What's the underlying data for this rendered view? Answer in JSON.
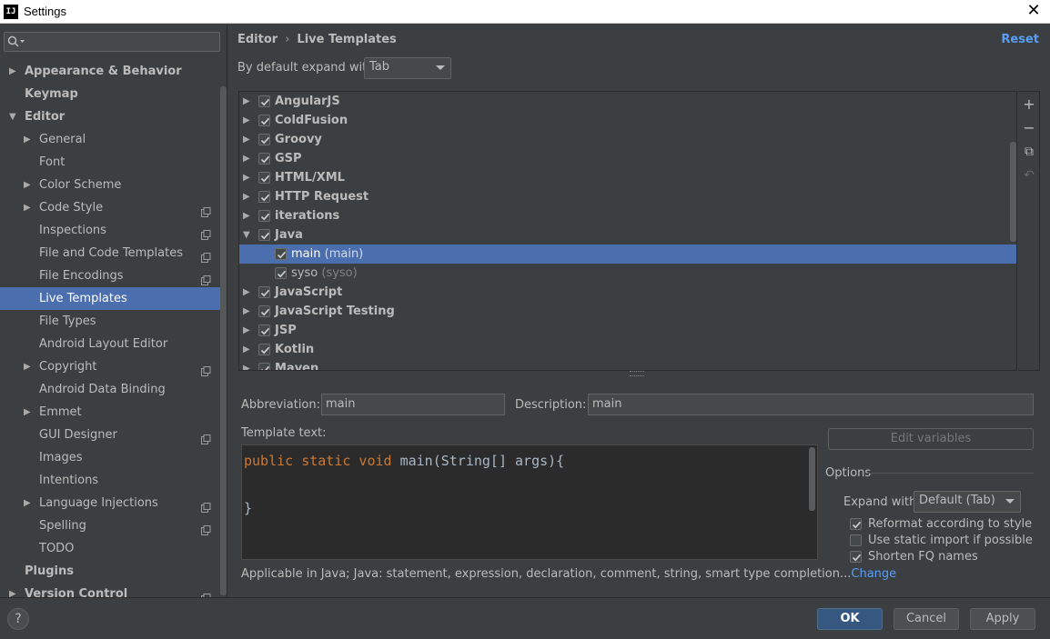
{
  "window": {
    "title": "Settings",
    "app_icon": "IJ",
    "close_glyph": "✕"
  },
  "search": {
    "placeholder": "",
    "value": ""
  },
  "sidebar": {
    "items": [
      {
        "label": "Appearance & Behavior",
        "level": 0,
        "bold": true,
        "arrow": "right"
      },
      {
        "label": "Keymap",
        "level": 0,
        "bold": true,
        "arrow": ""
      },
      {
        "label": "Editor",
        "level": 0,
        "bold": true,
        "arrow": "down"
      },
      {
        "label": "General",
        "level": 1,
        "bold": false,
        "arrow": "right"
      },
      {
        "label": "Font",
        "level": 1,
        "bold": false,
        "arrow": ""
      },
      {
        "label": "Color Scheme",
        "level": 1,
        "bold": false,
        "arrow": "right"
      },
      {
        "label": "Code Style",
        "level": 1,
        "bold": false,
        "arrow": "right",
        "project": true
      },
      {
        "label": "Inspections",
        "level": 1,
        "bold": false,
        "arrow": "",
        "project": true
      },
      {
        "label": "File and Code Templates",
        "level": 1,
        "bold": false,
        "arrow": "",
        "project": true
      },
      {
        "label": "File Encodings",
        "level": 1,
        "bold": false,
        "arrow": "",
        "project": true
      },
      {
        "label": "Live Templates",
        "level": 1,
        "bold": false,
        "arrow": "",
        "selected": true
      },
      {
        "label": "File Types",
        "level": 1,
        "bold": false,
        "arrow": ""
      },
      {
        "label": "Android Layout Editor",
        "level": 1,
        "bold": false,
        "arrow": ""
      },
      {
        "label": "Copyright",
        "level": 1,
        "bold": false,
        "arrow": "right",
        "project": true
      },
      {
        "label": "Android Data Binding",
        "level": 1,
        "bold": false,
        "arrow": ""
      },
      {
        "label": "Emmet",
        "level": 1,
        "bold": false,
        "arrow": "right"
      },
      {
        "label": "GUI Designer",
        "level": 1,
        "bold": false,
        "arrow": "",
        "project": true
      },
      {
        "label": "Images",
        "level": 1,
        "bold": false,
        "arrow": ""
      },
      {
        "label": "Intentions",
        "level": 1,
        "bold": false,
        "arrow": ""
      },
      {
        "label": "Language Injections",
        "level": 1,
        "bold": false,
        "arrow": "right",
        "project": true
      },
      {
        "label": "Spelling",
        "level": 1,
        "bold": false,
        "arrow": "",
        "project": true
      },
      {
        "label": "TODO",
        "level": 1,
        "bold": false,
        "arrow": ""
      },
      {
        "label": "Plugins",
        "level": 0,
        "bold": true,
        "arrow": ""
      },
      {
        "label": "Version Control",
        "level": 0,
        "bold": true,
        "arrow": "right",
        "project": true
      }
    ]
  },
  "header": {
    "breadcrumb_parent": "Editor",
    "breadcrumb_sep": "›",
    "breadcrumb_current": "Live Templates",
    "reset_label": "Reset"
  },
  "expand": {
    "label": "By default expand with",
    "value": "Tab"
  },
  "templates": [
    {
      "name": "AngularJS",
      "group": true,
      "expanded": false,
      "checked": true
    },
    {
      "name": "ColdFusion",
      "group": true,
      "expanded": false,
      "checked": true
    },
    {
      "name": "Groovy",
      "group": true,
      "expanded": false,
      "checked": true
    },
    {
      "name": "GSP",
      "group": true,
      "expanded": false,
      "checked": true
    },
    {
      "name": "HTML/XML",
      "group": true,
      "expanded": false,
      "checked": true
    },
    {
      "name": "HTTP Request",
      "group": true,
      "expanded": false,
      "checked": true
    },
    {
      "name": "iterations",
      "group": true,
      "expanded": false,
      "checked": true
    },
    {
      "name": "Java",
      "group": true,
      "expanded": true,
      "checked": true
    },
    {
      "name": "main",
      "desc": "(main)",
      "group": false,
      "checked": true,
      "selected": true
    },
    {
      "name": "syso",
      "desc": "(syso)",
      "group": false,
      "checked": true
    },
    {
      "name": "JavaScript",
      "group": true,
      "expanded": false,
      "checked": true
    },
    {
      "name": "JavaScript Testing",
      "group": true,
      "expanded": false,
      "checked": true
    },
    {
      "name": "JSP",
      "group": true,
      "expanded": false,
      "checked": true
    },
    {
      "name": "Kotlin",
      "group": true,
      "expanded": false,
      "checked": true
    },
    {
      "name": "Maven",
      "group": true,
      "expanded": false,
      "checked": true
    }
  ],
  "toolbar": {
    "add_glyph": "+",
    "remove_glyph": "−",
    "copy_glyph": "⧉",
    "restore_glyph": "↶"
  },
  "abbreviation": {
    "label": "Abbreviation:",
    "value": "main"
  },
  "description": {
    "label": "Description:",
    "value": "main"
  },
  "template_text": {
    "label": "Template text:",
    "line1_kw": "public static void",
    "line1_rest": " main(String[] args){",
    "line3": "}"
  },
  "edit_variables_label": "Edit variables",
  "options": {
    "title": "Options",
    "expand_label": "Expand with",
    "expand_value": "Default (Tab)",
    "reformat_label": "Reformat according to style",
    "reformat_checked": true,
    "static_import_label": "Use static import if possible",
    "static_import_checked": false,
    "shorten_label": "Shorten FQ names",
    "shorten_checked": true
  },
  "applicable": {
    "text": "Applicable in Java; Java: statement, expression, declaration, comment, string, smart type completion...",
    "link": "Change"
  },
  "buttons": {
    "help": "?",
    "ok": "OK",
    "cancel": "Cancel",
    "apply": "Apply"
  },
  "colors": {
    "selection": "#4b6eaf",
    "link": "#589df6",
    "keyword": "#cc7832",
    "background": "#3c3f41"
  }
}
